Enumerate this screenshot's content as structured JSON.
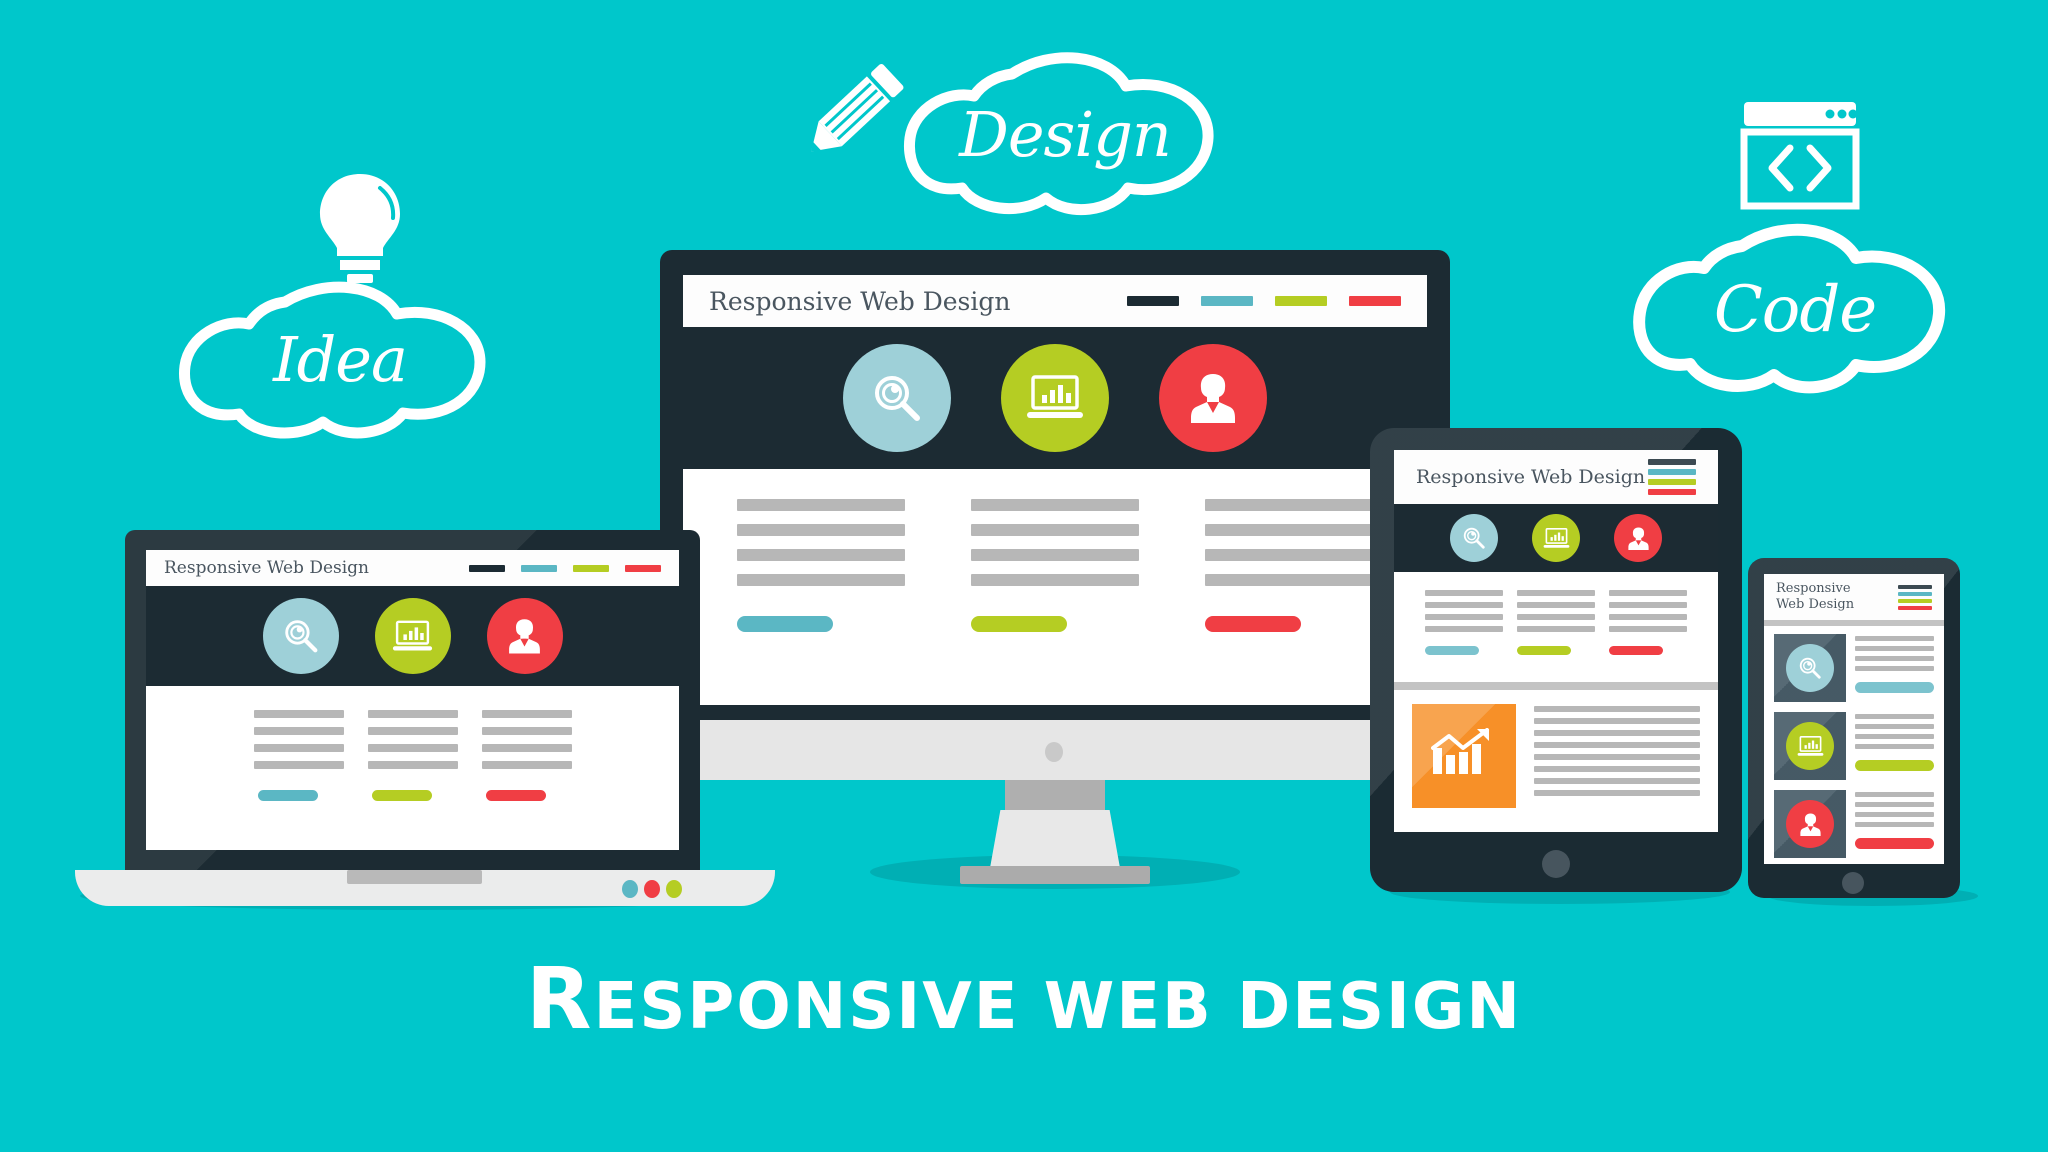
{
  "background_color": "#00C7CB",
  "palette": {
    "teal_bg": "#00C7CB",
    "dark_navy": "#1C2B33",
    "slate": "#4A5F6B",
    "accent_blue": "#78C1CC",
    "accent_green": "#B5CD23",
    "accent_red": "#F03E44",
    "accent_orange": "#F79028",
    "grey_line": "#B7B7B7",
    "white": "#FFFFFF"
  },
  "main_title": {
    "initial": "R",
    "rest": "esponsive web design",
    "full": "RESPONSIVE WEB DESIGN"
  },
  "clouds": [
    {
      "id": "idea",
      "label": "Idea",
      "icon": "lightbulb-icon"
    },
    {
      "id": "design",
      "label": "Design",
      "icon": "pencil-icon"
    },
    {
      "id": "code",
      "label": "Code",
      "icon": "browser-code-icon"
    }
  ],
  "site": {
    "title": "Responsive Web Design",
    "title_line1": "Responsive",
    "title_line2": "Web Design",
    "nav_colors": [
      "#1C2B33",
      "#5BB7C4",
      "#B5CD23",
      "#F03E44"
    ],
    "hero_icons": [
      {
        "name": "search-icon",
        "glyph": "magnifier",
        "color": "#9ED0D8"
      },
      {
        "name": "analytics-icon",
        "glyph": "laptop-chart",
        "color": "#B5CD23"
      },
      {
        "name": "user-icon",
        "glyph": "person",
        "color": "#F03E44"
      }
    ],
    "columns": [
      {
        "lines": 4,
        "button_color": "#5BB7C4"
      },
      {
        "lines": 4,
        "button_color": "#B5CD23"
      },
      {
        "lines": 4,
        "button_color": "#F03E44"
      }
    ],
    "article": {
      "image_icon": "bar-chart-growth-icon",
      "image_color": "#F79028",
      "text_lines": 8
    }
  },
  "devices": [
    {
      "id": "desktop",
      "name": "desktop-monitor",
      "layout": "3-column"
    },
    {
      "id": "laptop",
      "name": "laptop",
      "layout": "3-column"
    },
    {
      "id": "tablet",
      "name": "tablet",
      "layout": "3-column-plus-article"
    },
    {
      "id": "phone",
      "name": "smartphone",
      "layout": "stacked-rows"
    }
  ],
  "laptop": {
    "indicator_dots": [
      "#5BB7C4",
      "#F03E44",
      "#B5CD23"
    ]
  }
}
